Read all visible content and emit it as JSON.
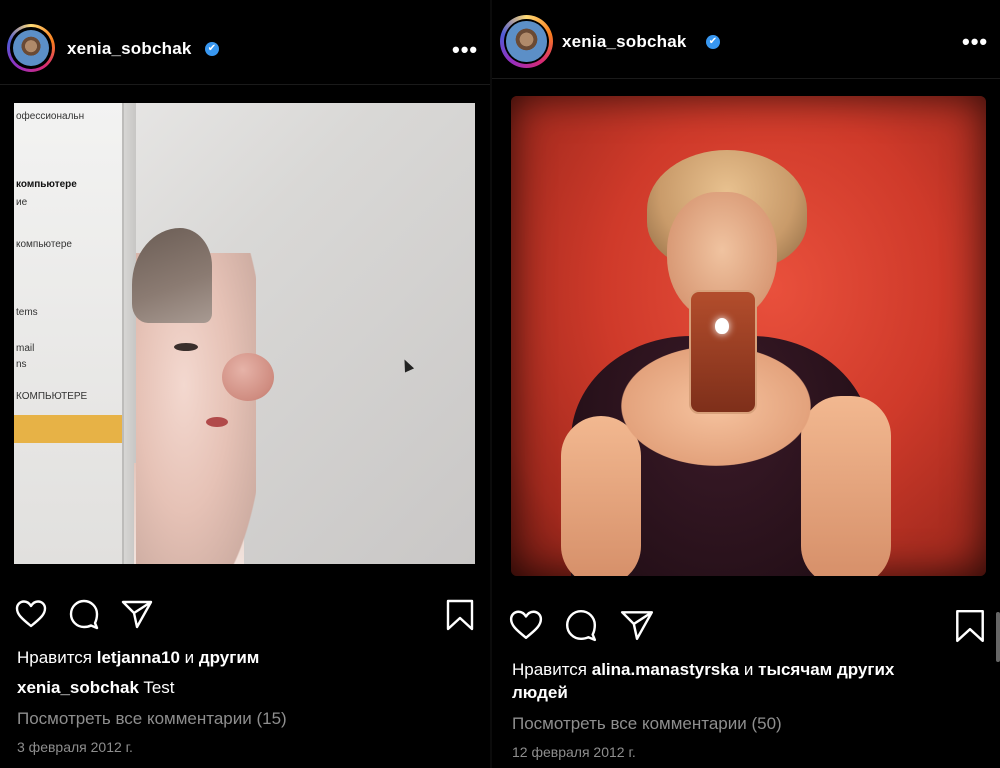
{
  "posts": [
    {
      "id": "left",
      "username": "xenia_sobchak",
      "verified_mark": "✔",
      "more_label": "•••",
      "photo_sidebar_lines": [
        "офессиональн",
        "компьютере",
        "ие",
        "компьютере",
        "tems",
        "mail",
        "ns",
        "КОМПЬЮТЕРЕ"
      ],
      "likes_prefix": "Нравится ",
      "likes_user": "letjanna10",
      "likes_conj": " и ",
      "likes_suffix": "другим",
      "likes_suffix_line2": "",
      "caption_user": "xenia_sobchak",
      "caption_text": " Test",
      "comments_link": "Посмотреть все комментарии (15)",
      "date": "3 февраля 2012 г.",
      "icons": [
        "heart-icon",
        "comment-icon",
        "share-icon",
        "bookmark-icon"
      ]
    },
    {
      "id": "right",
      "username": "xenia_sobchak",
      "verified_mark": "✔",
      "more_label": "•••",
      "likes_prefix": "Нравится ",
      "likes_user": "alina.manastyrska",
      "likes_conj": " и ",
      "likes_suffix": "тысячам других",
      "likes_suffix_line2": "людей",
      "comments_link": "Посмотреть все комментарии (50)",
      "date": "12 февраля 2012 г.",
      "icons": [
        "heart-icon",
        "comment-icon",
        "share-icon",
        "bookmark-icon"
      ]
    }
  ],
  "colors": {
    "background": "#000000",
    "text": "#ffffff",
    "muted": "#8e8e8e",
    "verified": "#3897f0"
  }
}
